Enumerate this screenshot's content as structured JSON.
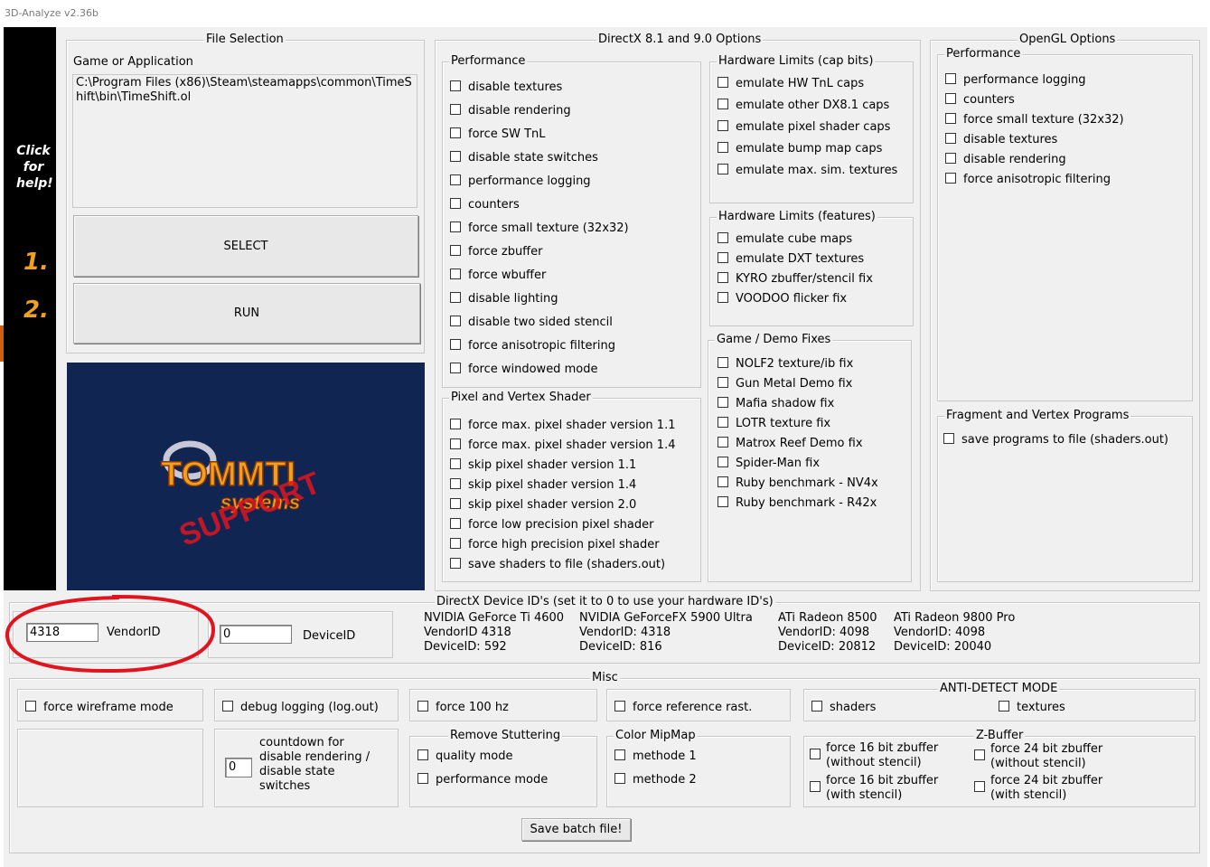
{
  "window": {
    "title": "3D-Analyze v2.36b"
  },
  "sidebar": {
    "help": [
      "Click",
      "for",
      "help!"
    ],
    "step1": "1.",
    "step2": "2."
  },
  "file_selection": {
    "title": "File Selection",
    "label": "Game or Application",
    "path": "C:\\Program Files (x86)\\Steam\\steamapps\\common\\TimeShift\\bin\\TimeShift.ol",
    "select": "SELECT",
    "run": "RUN"
  },
  "logo": {
    "line1": "TOMMTI",
    "line2": "systems",
    "overlay": "SUPPORT"
  },
  "dx": {
    "title": "DirectX 8.1 and 9.0 Options",
    "performance": {
      "title": "Performance",
      "items": [
        "disable textures",
        "disable rendering",
        "force SW TnL",
        "disable state switches",
        "performance logging",
        "counters",
        "force small texture (32x32)",
        "force zbuffer",
        "force wbuffer",
        "disable lighting",
        "disable two sided stencil",
        "force anisotropic filtering",
        "force windowed mode"
      ]
    },
    "pixel": {
      "title": "Pixel and Vertex Shader",
      "items": [
        "force max. pixel shader version 1.1",
        "force max. pixel shader version 1.4",
        "skip pixel shader version 1.1",
        "skip pixel shader version 1.4",
        "skip pixel shader version 2.0",
        "force low precision pixel shader",
        "force high precision pixel shader",
        "save shaders to file (shaders.out)"
      ]
    },
    "hw_caps": {
      "title": "Hardware Limits (cap bits)",
      "items": [
        "emulate HW TnL caps",
        "emulate other DX8.1 caps",
        "emulate pixel shader caps",
        "emulate bump map caps",
        "emulate max. sim. textures"
      ]
    },
    "hw_features": {
      "title": "Hardware Limits (features)",
      "items": [
        "emulate cube maps",
        "emulate DXT textures",
        "KYRO zbuffer/stencil fix",
        "VOODOO flicker fix"
      ]
    },
    "game_fixes": {
      "title": "Game / Demo Fixes",
      "items": [
        "NOLF2 texture/ib fix",
        "Gun Metal Demo fix",
        "Mafia shadow fix",
        "LOTR texture fix",
        "Matrox Reef Demo fix",
        "Spider-Man fix",
        "Ruby benchmark - NV4x",
        "Ruby benchmark - R42x"
      ]
    }
  },
  "opengl": {
    "title": "OpenGL Options",
    "performance": {
      "title": "Performance",
      "items": [
        "performance logging",
        "counters",
        "force small texture (32x32)",
        "disable textures",
        "disable rendering",
        "force anisotropic filtering"
      ]
    },
    "fragment": {
      "title": "Fragment and Vertex Programs",
      "items": [
        "save programs to file (shaders.out)"
      ]
    }
  },
  "device_ids": {
    "title": "DirectX Device ID's (set it to 0 to use your hardware ID's)",
    "vendor_value": "4318",
    "vendor_label": "VendorID",
    "device_value": "0",
    "device_label": "DeviceID",
    "presets": [
      [
        "NVIDIA GeForce Ti 4600",
        "VendorID 4318",
        "DeviceID: 592"
      ],
      [
        "NVIDIA GeForceFX 5900 Ultra",
        "VendorID: 4318",
        "DeviceID: 816"
      ],
      [
        "ATi Radeon 8500",
        "VendorID: 4098",
        "DeviceID: 20812"
      ],
      [
        "ATi Radeon 9800 Pro",
        "VendorID: 4098",
        "DeviceID: 20040"
      ]
    ]
  },
  "misc": {
    "title": "Misc",
    "wireframe": "force wireframe mode",
    "debug": "debug logging (log.out)",
    "force100": "force 100 hz",
    "refrast": "force reference rast.",
    "countdown_value": "0",
    "countdown_label": [
      "countdown for",
      "disable rendering /",
      "disable state",
      "switches"
    ],
    "stutter": {
      "title": "Remove Stuttering",
      "items": [
        "quality mode",
        "performance mode"
      ]
    },
    "mipmap": {
      "title": "Color MipMap",
      "items": [
        "methode 1",
        "methode 2"
      ]
    },
    "antidetect": {
      "title": "ANTI-DETECT MODE",
      "items": [
        "shaders",
        "textures"
      ]
    },
    "zbuffer": {
      "title": "Z-Buffer",
      "items": [
        [
          "force 16 bit zbuffer",
          "(without stencil)"
        ],
        [
          "force 16 bit zbuffer",
          "(with stencil)"
        ],
        [
          "force 24 bit zbuffer",
          "(without stencil)"
        ],
        [
          "force 24 bit zbuffer",
          "(with stencil)"
        ]
      ]
    },
    "save_batch": "Save batch file!"
  },
  "colors": {
    "window_bg": "#f0f0f0",
    "logo_bg": "#102552",
    "annotation_red": "#e0141e",
    "step_orange": "#f0a020"
  }
}
